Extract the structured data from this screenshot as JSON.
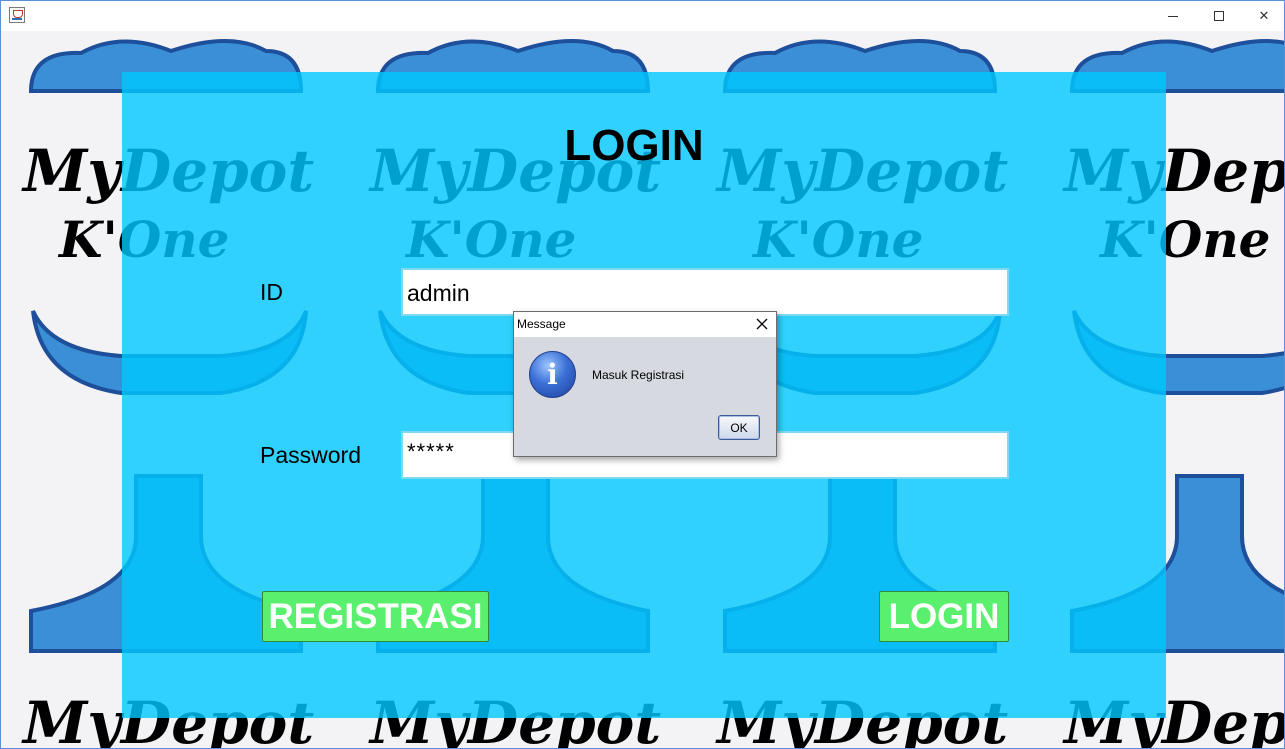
{
  "window": {
    "minimize_glyph": "",
    "close_glyph": "✕"
  },
  "background": {
    "logo_line1": "MyDepot",
    "logo_line2": "K'One"
  },
  "form": {
    "title": "LOGIN",
    "id_label": "ID",
    "id_value": "admin",
    "password_label": "Password",
    "password_value": "*****",
    "register_button": "REGISTRASI",
    "login_button": "LOGIN"
  },
  "dialog": {
    "title": "Message",
    "close_glyph": "✕",
    "icon_glyph": "i",
    "message": "Masuk Registrasi",
    "ok_label": "OK"
  },
  "colors": {
    "panel": "#00c8ff",
    "button": "#5af06e",
    "dialog_bg": "#d6d9df"
  }
}
